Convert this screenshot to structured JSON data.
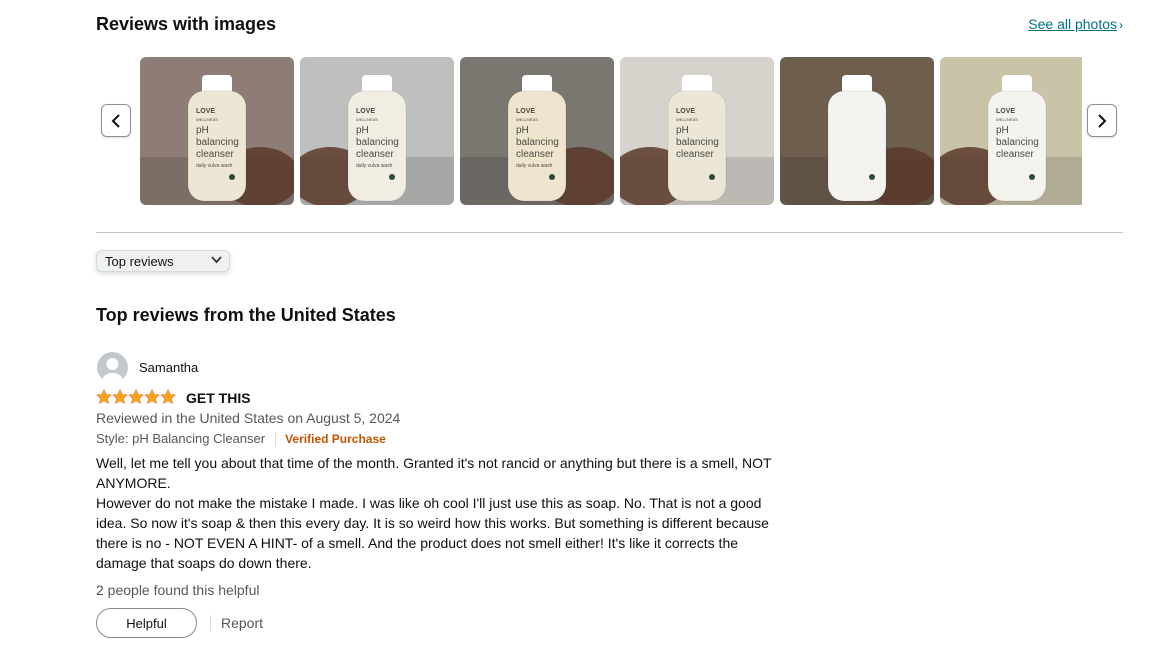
{
  "section": {
    "title": "Reviews with images",
    "see_all": "See all photos",
    "see_all_chevron": "›"
  },
  "carousel": {
    "prev_icon": "chevron-left-icon",
    "next_icon": "chevron-right-icon",
    "thumbnails": [
      {
        "brand": "LOVE",
        "sub": "WELLNESS",
        "text1": "pH",
        "text2": "balancing",
        "text3": "cleanser",
        "text4": "daily vulva wash",
        "bg": "#8e7d76",
        "bottle": "#eee6d4"
      },
      {
        "brand": "LOVE",
        "sub": "WELLNESS",
        "text1": "pH",
        "text2": "balancing",
        "text3": "cleanser",
        "text4": "daily vulva wash",
        "bg": "#bfbfbd",
        "bottle": "#f1ede2"
      },
      {
        "brand": "LOVE",
        "sub": "WELLNESS",
        "text1": "pH",
        "text2": "balancing",
        "text3": "cleanser",
        "text4": "daily vulva wash",
        "bg": "#7a7670",
        "bottle": "#efe5cf"
      },
      {
        "brand": "LOVE",
        "sub": "WELLNESS",
        "text1": "pH",
        "text2": "balancing",
        "text3": "cleanser",
        "text4": "",
        "bg": "#d6d2cc",
        "bottle": "#ece6d6"
      },
      {
        "brand": "",
        "sub": "",
        "text1": "",
        "text2": "",
        "text3": "",
        "text4": "",
        "bg": "#6e5e4e",
        "bottle": "#f4f3ef"
      },
      {
        "brand": "LOVE",
        "sub": "WELLNESS",
        "text1": "pH",
        "text2": "balancing",
        "text3": "cleanser",
        "text4": "",
        "bg": "#c9c3a8",
        "bottle": "#f5f3ee"
      }
    ]
  },
  "sort": {
    "selected": "Top reviews",
    "caret_icon": "chevron-down-icon"
  },
  "reviews_heading": "Top reviews from the United States",
  "review": {
    "reviewer": "Samantha",
    "rating": 5,
    "title": "GET THIS",
    "date_line": "Reviewed in the United States on August 5, 2024",
    "style": "Style: pH Balancing Cleanser",
    "verified": "Verified Purchase",
    "body_p1": "Well, let me tell you about that time of the month. Granted it's not rancid or anything but there is a smell, NOT ANYMORE.",
    "body_p2": "However do not make the mistake I made. I was like oh cool I'll just use this as soap. No. That is not a good idea. So now it's soap & then this every day. It is so weird how this works. But something is different because there is no - NOT EVEN A HINT- of a smell. And the product does not smell either! It's like it corrects the damage that soaps do down there.",
    "helpful_count": "2 people found this helpful",
    "helpful_button": "Helpful",
    "report": "Report"
  },
  "colors": {
    "link": "#007185",
    "star": "#ffa41c",
    "verified": "#c45500"
  }
}
